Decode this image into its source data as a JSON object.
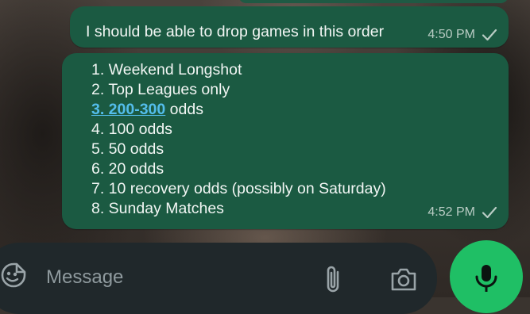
{
  "messages": [
    {
      "text": "I should be able to drop games in this order",
      "time": "4:50 PM",
      "status_icon": "single-check-icon"
    },
    {
      "items": [
        "1. Weekend Longshot",
        "2. Top Leagues only",
        "odds",
        "4. 100 odds",
        "5. 50 odds",
        "6. 20 odds",
        "7. 10 recovery odds (possibly on Saturday)",
        "8. Sunday Matches"
      ],
      "link_text": "3. 200-300",
      "time": "4:52 PM",
      "status_icon": "single-check-icon"
    }
  ],
  "composer": {
    "placeholder": "Message",
    "emoji_icon": "emoji-sticker-icon",
    "attach_icon": "paperclip-icon",
    "camera_icon": "camera-icon",
    "send_icon": "microphone-icon"
  },
  "colors": {
    "bubble": "#1b5a42",
    "link": "#53bdeb",
    "mic_button": "#1fbf65",
    "composer": "#20282b"
  }
}
